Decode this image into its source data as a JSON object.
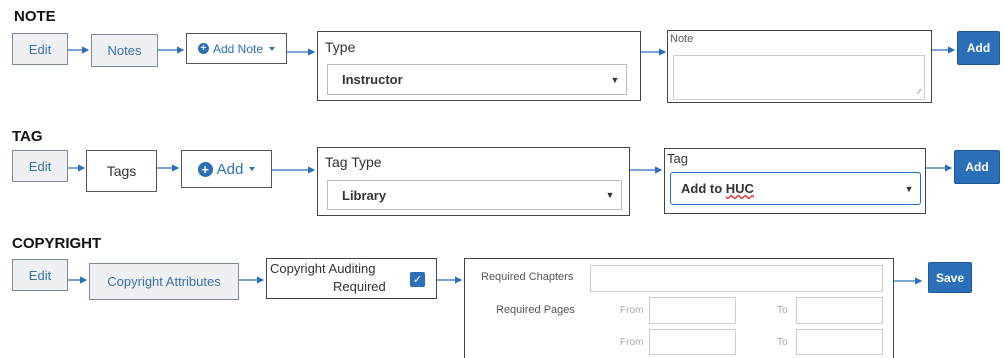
{
  "note": {
    "title": "NOTE",
    "edit_label": "Edit",
    "notes_label": "Notes",
    "add_note_label": "Add Note",
    "type_label": "Type",
    "type_value": "Instructor",
    "note_label": "Note",
    "add_label": "Add"
  },
  "tag": {
    "title": "TAG",
    "edit_label": "Edit",
    "tags_label": "Tags",
    "add_dropdown_label": "Add",
    "tag_type_label": "Tag Type",
    "tag_type_value": "Library",
    "tag_label": "Tag",
    "tag_value_prefix": "Add to ",
    "tag_value_highlight": "HUC",
    "add_label": "Add"
  },
  "copyright": {
    "title": "COPYRIGHT",
    "edit_label": "Edit",
    "attributes_label": "Copyright Attributes",
    "auditing_line1": "Copyright Auditing",
    "auditing_line2": "Required",
    "required_chapters_label": "Required Chapters",
    "required_pages_label": "Required Pages",
    "from_label": "From",
    "to_label": "To",
    "save_label": "Save"
  },
  "colors": {
    "primary_blue": "#2a6fb8",
    "arrow_blue": "#2a6fb8",
    "grey_button": "#eef0f3",
    "misspell_red": "#d22"
  }
}
